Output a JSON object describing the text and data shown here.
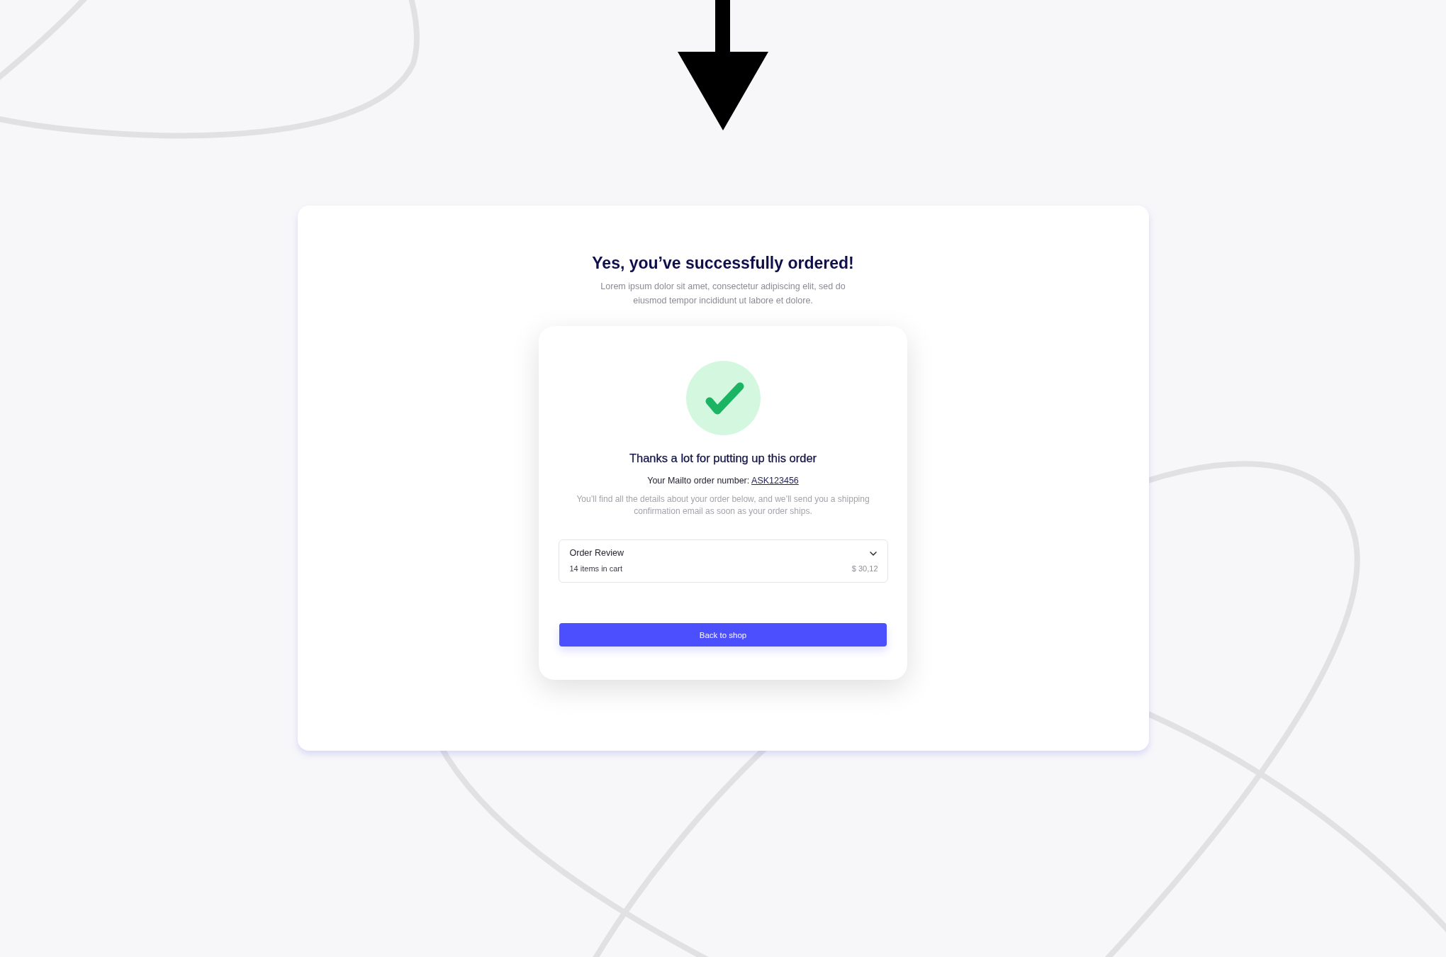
{
  "page": {
    "title": "Yes, you’ve successfully ordered!",
    "subtitle": "Lorem ipsum dolor sit amet, consectetur adipiscing elit, sed do eiusmod tempor incididunt ut labore et dolore.",
    "confirmation": {
      "heading": "Thanks a lot for putting up this order",
      "order_number_label": "Your Mailto order number:",
      "order_number": "ASK123456",
      "message": "You’ll find all the details about your order below, and we’ll send you a shipping confirmation email as soon as your order ships.",
      "order_review": {
        "title": "Order Review",
        "item_count": "14 items in cart",
        "total": "$ 30,12",
        "expanded": false
      },
      "button": "Back to shop"
    }
  }
}
